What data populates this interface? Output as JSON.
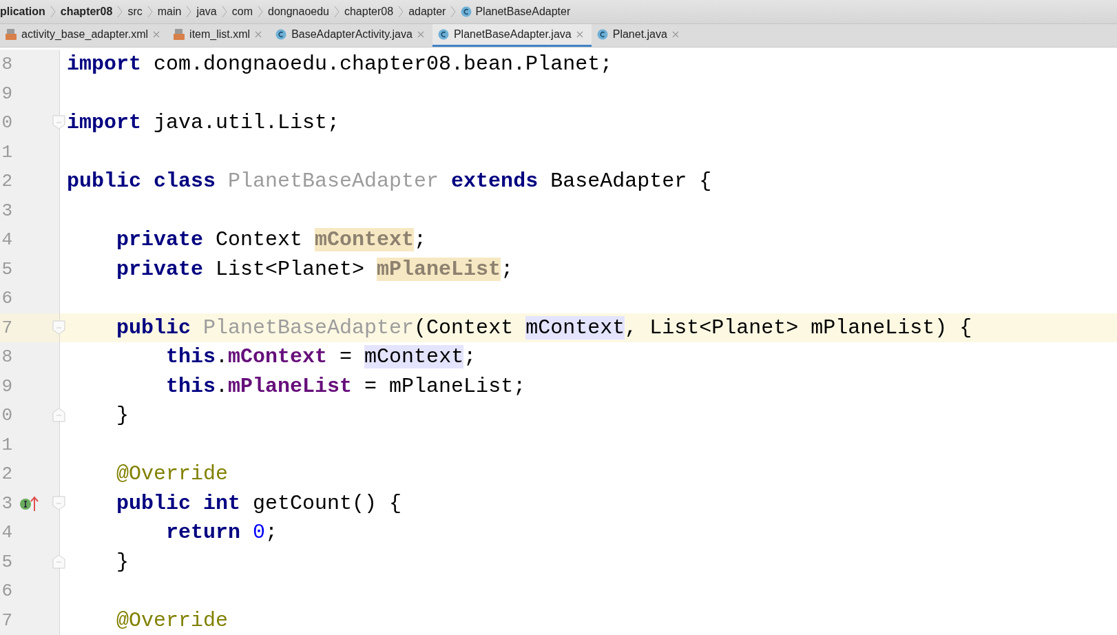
{
  "breadcrumbs": [
    {
      "label": "plication",
      "bold": true
    },
    {
      "label": "chapter08",
      "bold": true
    },
    {
      "label": "src",
      "bold": false
    },
    {
      "label": "main",
      "bold": false
    },
    {
      "label": "java",
      "bold": false
    },
    {
      "label": "com",
      "bold": false
    },
    {
      "label": "dongnaoedu",
      "bold": false
    },
    {
      "label": "chapter08",
      "bold": false
    },
    {
      "label": "adapter",
      "bold": false
    },
    {
      "label": "PlanetBaseAdapter",
      "bold": false,
      "kind": "class"
    }
  ],
  "tabs": [
    {
      "label": "activity_base_adapter.xml",
      "kind": "xml",
      "selected": false
    },
    {
      "label": "item_list.xml",
      "kind": "xml",
      "selected": false
    },
    {
      "label": "BaseAdapterActivity.java",
      "kind": "class",
      "selected": false
    },
    {
      "label": "PlanetBaseAdapter.java",
      "kind": "class",
      "selected": true
    },
    {
      "label": "Planet.java",
      "kind": "class",
      "selected": false
    }
  ],
  "lines": [
    {
      "num": "8",
      "tokens": [
        {
          "text": "import ",
          "kind": "kw"
        },
        {
          "text": "com.dongnaoedu.chapter08.bean.Planet;",
          "kind": "plain"
        }
      ]
    },
    {
      "num": "9"
    },
    {
      "num": "0",
      "fold_start": true,
      "tokens": [
        {
          "text": "import ",
          "kind": "kw"
        },
        {
          "text": "java.util.List;",
          "kind": "plain"
        }
      ]
    },
    {
      "num": "1"
    },
    {
      "num": "2",
      "tokens": [
        {
          "text": "public class ",
          "kind": "kw"
        },
        {
          "text": "PlanetBaseAdapter",
          "kind": "decl"
        },
        {
          "text": " extends ",
          "kind": "kw"
        },
        {
          "text": "BaseAdapter {",
          "kind": "plain"
        }
      ]
    },
    {
      "num": "3"
    },
    {
      "num": "4",
      "tokens": [
        {
          "text": "    private ",
          "kind": "kw"
        },
        {
          "text": "Context ",
          "kind": "plain"
        },
        {
          "text": "mContext",
          "kind": "unused",
          "read_highlight": true
        },
        {
          "text": ";",
          "kind": "plain"
        }
      ]
    },
    {
      "num": "5",
      "tokens": [
        {
          "text": "    private ",
          "kind": "kw"
        },
        {
          "text": "List<Planet> ",
          "kind": "plain"
        },
        {
          "text": "mPlaneList",
          "kind": "unused",
          "read_highlight": true
        },
        {
          "text": ";",
          "kind": "plain"
        }
      ]
    },
    {
      "num": "6"
    },
    {
      "num": "7",
      "fold_start": true,
      "current": true,
      "tokens": [
        {
          "text": "    public ",
          "kind": "kw"
        },
        {
          "text": "PlanetBaseAdapter",
          "kind": "decl"
        },
        {
          "text": "(Context ",
          "kind": "plain"
        },
        {
          "text": "mContext",
          "kind": "plain",
          "write_highlight": true
        },
        {
          "text": ", List<Planet> mPlaneList) {",
          "kind": "plain"
        }
      ]
    },
    {
      "num": "8",
      "tokens": [
        {
          "text": "        this",
          "kind": "kw"
        },
        {
          "text": ".",
          "kind": "plain"
        },
        {
          "text": "mContext",
          "kind": "field"
        },
        {
          "text": " = ",
          "kind": "plain"
        },
        {
          "text": "mContext",
          "kind": "plain",
          "write_highlight": true
        },
        {
          "text": ";",
          "kind": "plain"
        }
      ]
    },
    {
      "num": "9",
      "tokens": [
        {
          "text": "        this",
          "kind": "kw"
        },
        {
          "text": ".",
          "kind": "plain"
        },
        {
          "text": "mPlaneList",
          "kind": "field"
        },
        {
          "text": " = mPlaneList;",
          "kind": "plain"
        }
      ]
    },
    {
      "num": "0",
      "fold_end": true,
      "tokens": [
        {
          "text": "    }",
          "kind": "plain"
        }
      ]
    },
    {
      "num": "1"
    },
    {
      "num": "2",
      "tokens": [
        {
          "text": "    @Override",
          "kind": "ann"
        }
      ]
    },
    {
      "num": "3",
      "fold_start": true,
      "implements": true,
      "tokens": [
        {
          "text": "    public int ",
          "kind": "kw"
        },
        {
          "text": "getCount() {",
          "kind": "plain"
        }
      ]
    },
    {
      "num": "4",
      "tokens": [
        {
          "text": "        return ",
          "kind": "kw"
        },
        {
          "text": "0",
          "kind": "num"
        },
        {
          "text": ";",
          "kind": "plain"
        }
      ]
    },
    {
      "num": "5",
      "fold_end": true,
      "tokens": [
        {
          "text": "    }",
          "kind": "plain"
        }
      ]
    },
    {
      "num": "6"
    },
    {
      "num": "7",
      "tokens": [
        {
          "text": "    @Override",
          "kind": "ann"
        }
      ]
    }
  ]
}
